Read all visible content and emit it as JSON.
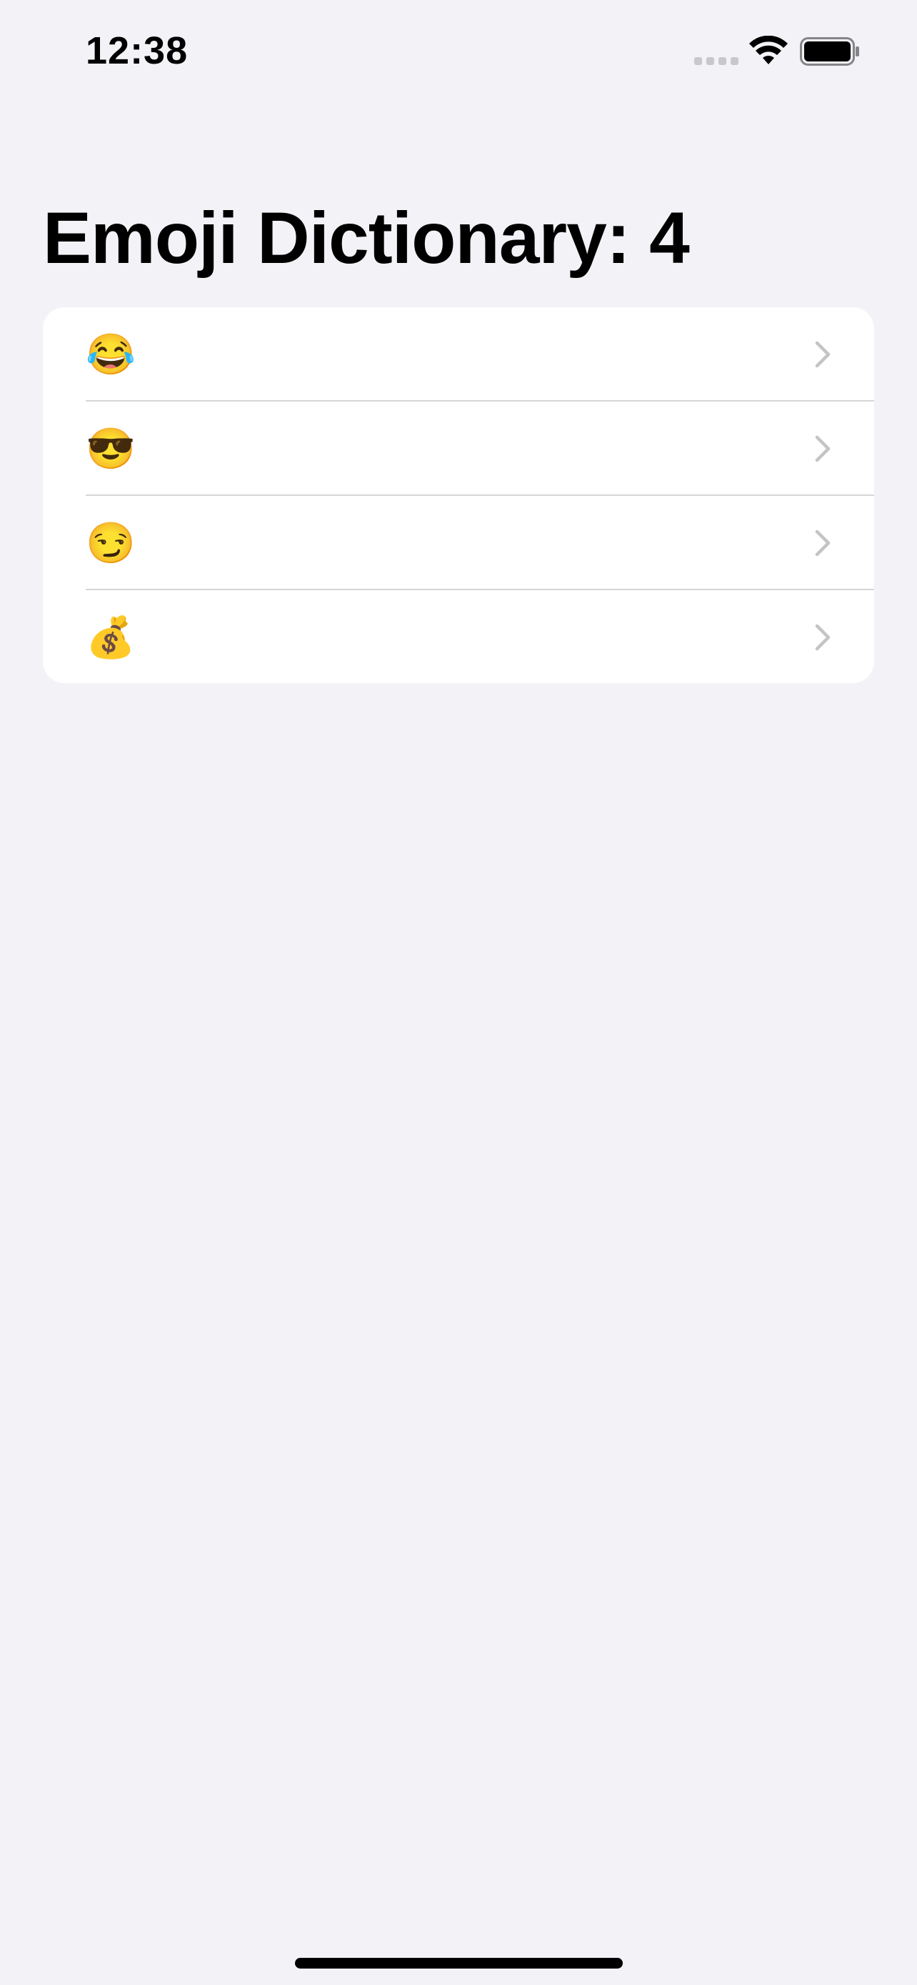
{
  "status_bar": {
    "time": "12:38"
  },
  "header": {
    "title": "Emoji Dictionary: 4"
  },
  "list": {
    "items": [
      {
        "emoji": "😂",
        "icon": "chevron-right-icon"
      },
      {
        "emoji": "😎",
        "icon": "chevron-right-icon"
      },
      {
        "emoji": "😏",
        "icon": "chevron-right-icon"
      },
      {
        "emoji": "💰",
        "icon": "chevron-right-icon"
      }
    ]
  },
  "colors": {
    "background": "#f2f2f7",
    "card": "#ffffff",
    "separator": "#d6d6da",
    "chevron": "#c4c4c7"
  }
}
